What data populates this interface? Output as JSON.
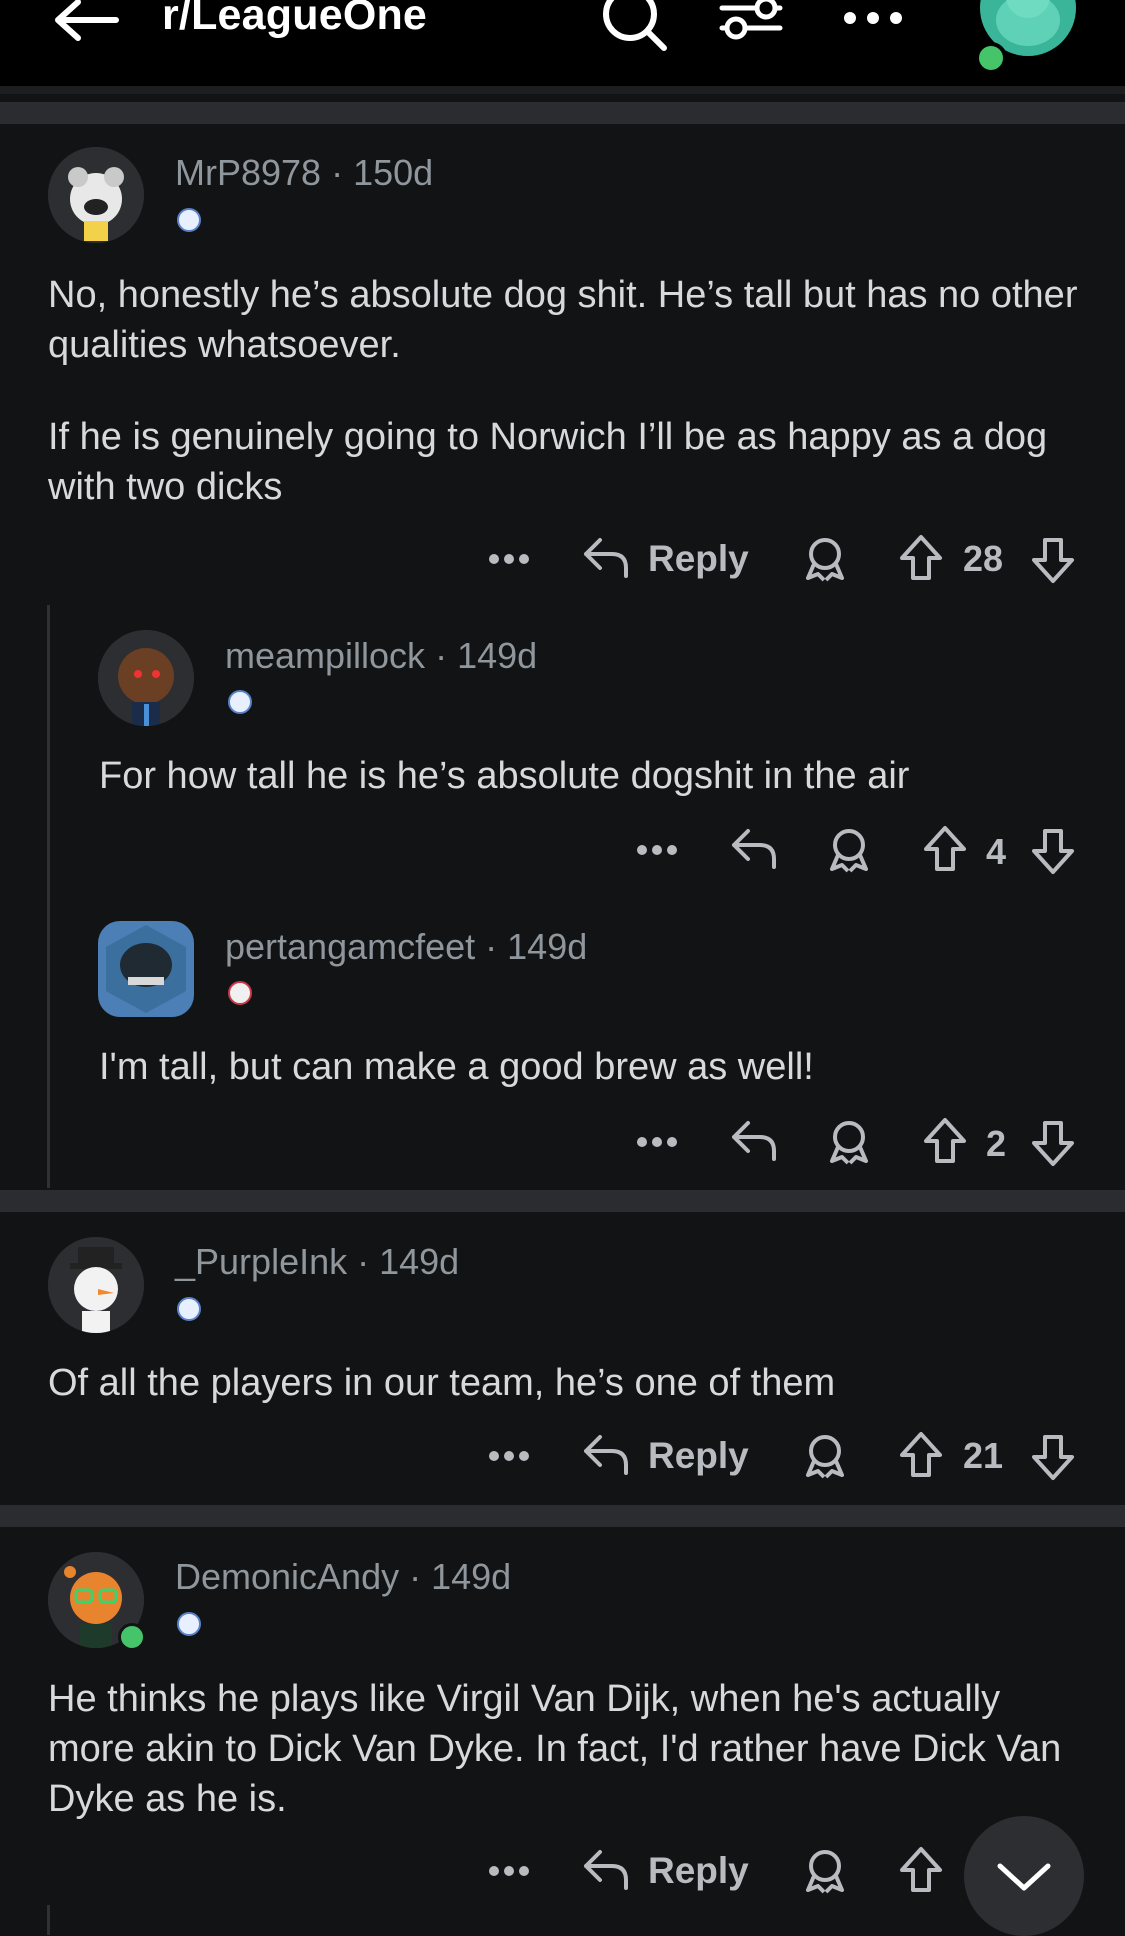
{
  "header": {
    "title": "r/LeagueOne",
    "icons": [
      "back-arrow-icon",
      "search-icon",
      "filter-icon",
      "more-icon",
      "user-avatar"
    ]
  },
  "comments": [
    {
      "user": "MrP8978",
      "age": "150d",
      "body": [
        "No, honestly he’s absolute dog shit. He’s tall but has no other qualities whatsoever.",
        "If he is genuinely going to Norwich I’ll be as happy as a dog with two dicks"
      ],
      "reply_label": "Reply",
      "votes": "28"
    },
    {
      "user": "meampillock",
      "age": "149d",
      "body": [
        "For how tall he is he’s absolute dogshit in the air"
      ],
      "votes": "4"
    },
    {
      "user": "pertangamcfeet",
      "age": "149d",
      "body": [
        "I'm tall, but can make a good brew as well!"
      ],
      "votes": "2"
    },
    {
      "user": "_PurpleInk",
      "age": "149d",
      "body": [
        "Of all the players in our team, he’s one of them"
      ],
      "reply_label": "Reply",
      "votes": "21"
    },
    {
      "user": "DemonicAndy",
      "age": "149d",
      "body": [
        "He thinks he plays like Virgil Van Dijk, when he's actually more akin to Dick Van Dyke. In fact, I'd rather have Dick Van Dyke as he is."
      ],
      "reply_label": "Reply",
      "votes": ""
    }
  ],
  "colors": {
    "background": "#111315",
    "header": "#000000",
    "separator": "#2a2c2f",
    "text": "#d7dadc",
    "meta": "#8f969c"
  }
}
